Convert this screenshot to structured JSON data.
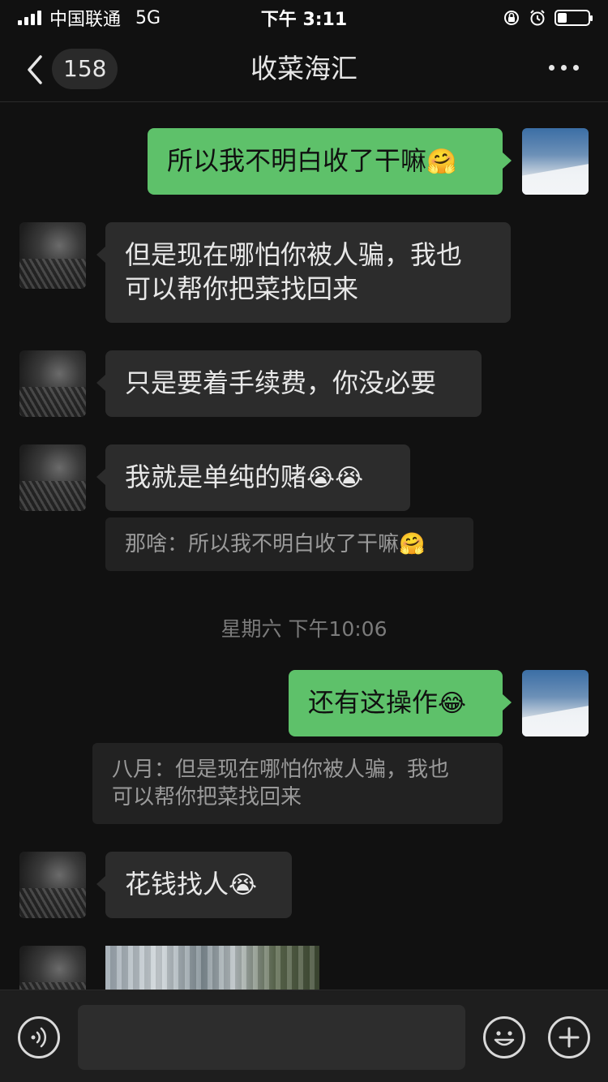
{
  "status_bar": {
    "carrier": "中国联通",
    "network": "5G",
    "time": "下午 3:11",
    "battery_level": 0.3
  },
  "nav": {
    "unread_count": "158",
    "title": "收菜海汇"
  },
  "messages": [
    {
      "side": "out",
      "text": "所以我不明白收了干嘛",
      "emoji": "🤗"
    },
    {
      "side": "in",
      "line1": "但是现在哪怕你被人骗，我也",
      "line2": "可以帮你把菜找回来"
    },
    {
      "side": "in",
      "text": "只是要着手续费，你没必要"
    },
    {
      "side": "in",
      "text": "我就是单纯的赌",
      "emoji": "😭😭"
    },
    {
      "type": "quote",
      "text": "那啥：所以我不明白收了干嘛",
      "emoji": "🤗"
    },
    {
      "type": "time",
      "text": "星期六 下午10:06"
    },
    {
      "side": "out",
      "text": "还有这操作",
      "emoji": "😂"
    },
    {
      "type": "quote",
      "line1": "八月：但是现在哪怕你被人骗，我也",
      "line2": "可以帮你把菜找回来"
    },
    {
      "side": "in",
      "text": "花钱找人",
      "emoji": "😭"
    },
    {
      "side": "in",
      "type": "image"
    }
  ],
  "icons": {
    "back": "chevron-left-icon",
    "more": "more-dots-icon",
    "voice": "voice-icon",
    "emoji": "emoji-icon",
    "add": "plus-icon"
  },
  "colors": {
    "background": "#111111",
    "bubble_in": "#2c2c2c",
    "bubble_out": "#5ec16a",
    "quote_bg": "#222222"
  }
}
